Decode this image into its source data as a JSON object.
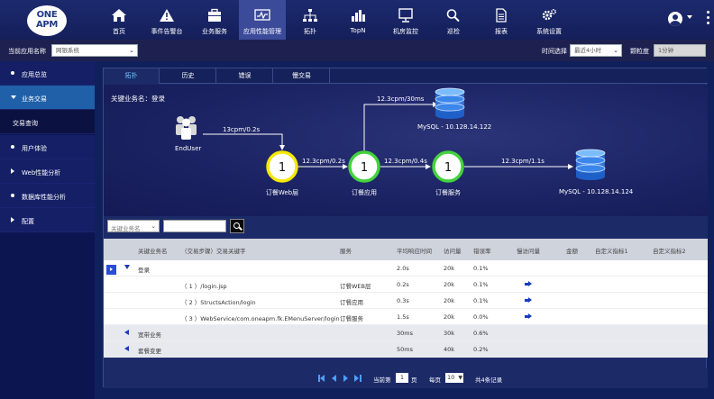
{
  "logo": {
    "line1": "ONE",
    "line2": "APM"
  },
  "nav": [
    {
      "label": "首页",
      "icon": "home-icon"
    },
    {
      "label": "事件告警台",
      "icon": "warning-icon"
    },
    {
      "label": "业务服务",
      "icon": "briefcase-icon"
    },
    {
      "label": "应用性能管理",
      "icon": "monitor-icon",
      "active": true
    },
    {
      "label": "拓扑",
      "icon": "topology-icon"
    },
    {
      "label": "TopN",
      "icon": "bar-chart-icon"
    },
    {
      "label": "机房监控",
      "icon": "display-icon"
    },
    {
      "label": "巡检",
      "icon": "search-icon"
    },
    {
      "label": "报表",
      "icon": "report-icon"
    },
    {
      "label": "系统设置",
      "icon": "gears-icon"
    }
  ],
  "subbar": {
    "app_label": "当前应用名称",
    "app_value": "网银系统",
    "time_label": "时间选择",
    "time_value": "最近4小时",
    "granularity_label": "颗粒度",
    "granularity_value": "1分钟"
  },
  "sidebar": [
    {
      "label": "应用总览",
      "mark": "dot"
    },
    {
      "label": "业务交易",
      "mark": "down",
      "open": true
    },
    {
      "label": "交易查询",
      "mark": "none",
      "sub": true
    },
    {
      "label": "用户体验",
      "mark": "dot"
    },
    {
      "label": "Web性能分析",
      "mark": "right"
    },
    {
      "label": "数据库性能分析",
      "mark": "dot"
    },
    {
      "label": "配置",
      "mark": "right"
    }
  ],
  "tabs": [
    "拓扑",
    "历史",
    "错误",
    "慢交易"
  ],
  "topology": {
    "title": "关键业务名：登录",
    "enduser": "EndUser",
    "edges": [
      "13cpm/0.2s",
      "12.3cpm/0.2s",
      "12.3cpm/0.4s",
      "12.3cpm/30ms",
      "12.3cpm/1.1s"
    ],
    "nodes": [
      {
        "count": "1",
        "label": "订餐Web层"
      },
      {
        "count": "1",
        "label": "订餐应用"
      },
      {
        "count": "1",
        "label": "订餐服务"
      }
    ],
    "db1": "MySQL - 10.128.14.122",
    "db2": "MySQL - 10.128.14.124"
  },
  "filter": {
    "select_value": "关键业务名",
    "input_value": ""
  },
  "table": {
    "headers": [
      "关键业务名",
      "（交易步骤）交易关键字",
      "服务",
      "平均响应时间",
      "访问量",
      "错误率",
      "慢访问量",
      "金额",
      "自定义指标1",
      "自定义指标2"
    ],
    "rows": [
      {
        "name": "登录",
        "keyword": "",
        "service": "",
        "avg": "2.0s",
        "visits": "20k",
        "err": "0.1%",
        "type": "parent-open"
      },
      {
        "name": "",
        "keyword": "（ 1 ）/login.jsp",
        "service": "订餐WEB层",
        "avg": "0.2s",
        "visits": "20k",
        "err": "0.1%",
        "type": "child"
      },
      {
        "name": "",
        "keyword": "（ 2 ）StructsAction/login",
        "service": "订餐应用",
        "avg": "0.3s",
        "visits": "20k",
        "err": "0.1%",
        "type": "child"
      },
      {
        "name": "",
        "keyword": "（ 3 ）WebService/com.oneapm.fk.EMenuServer/login",
        "service": "订餐服务",
        "avg": "1.5s",
        "visits": "20k",
        "err": "0.0%",
        "type": "child"
      },
      {
        "name": "宽带业务",
        "keyword": "",
        "service": "",
        "avg": "30ms",
        "visits": "30k",
        "err": "0.6%",
        "type": "parent"
      },
      {
        "name": "套餐变更",
        "keyword": "",
        "service": "",
        "avg": "50ms",
        "visits": "40k",
        "err": "0.2%",
        "type": "parent"
      }
    ]
  },
  "pager": {
    "current_label": "当前第",
    "page": "1",
    "page_unit": "页",
    "per_label": "每页",
    "per_value": "10",
    "total": "共4条记录"
  }
}
